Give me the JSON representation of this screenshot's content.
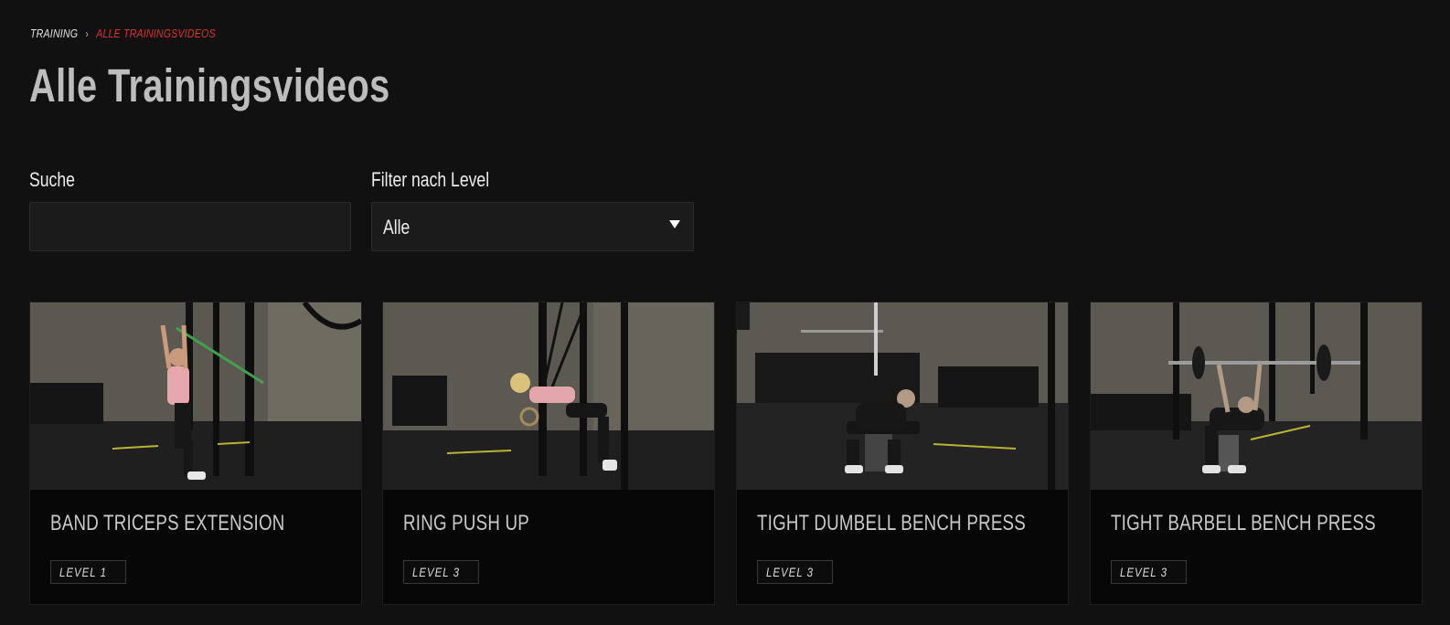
{
  "breadcrumb": {
    "parent": "TRAINING",
    "separator": "›",
    "current": "ALLE TRAININGSVIDEOS"
  },
  "page": {
    "title": "Alle Trainingsvideos"
  },
  "search": {
    "label": "Suche",
    "value": "",
    "placeholder": ""
  },
  "level_filter": {
    "label": "Filter nach Level",
    "selected": "Alle"
  },
  "videos": [
    {
      "title": "BAND TRICEPS EXTENSION",
      "level": "LEVEL 1"
    },
    {
      "title": "RING PUSH UP",
      "level": "LEVEL 3"
    },
    {
      "title": "TIGHT DUMBELL BENCH PRESS",
      "level": "LEVEL 3"
    },
    {
      "title": "TIGHT BARBELL BENCH PRESS",
      "level": "LEVEL 3"
    }
  ],
  "colors": {
    "background": "#111111",
    "accent": "#d9322d",
    "card": "#070707"
  }
}
